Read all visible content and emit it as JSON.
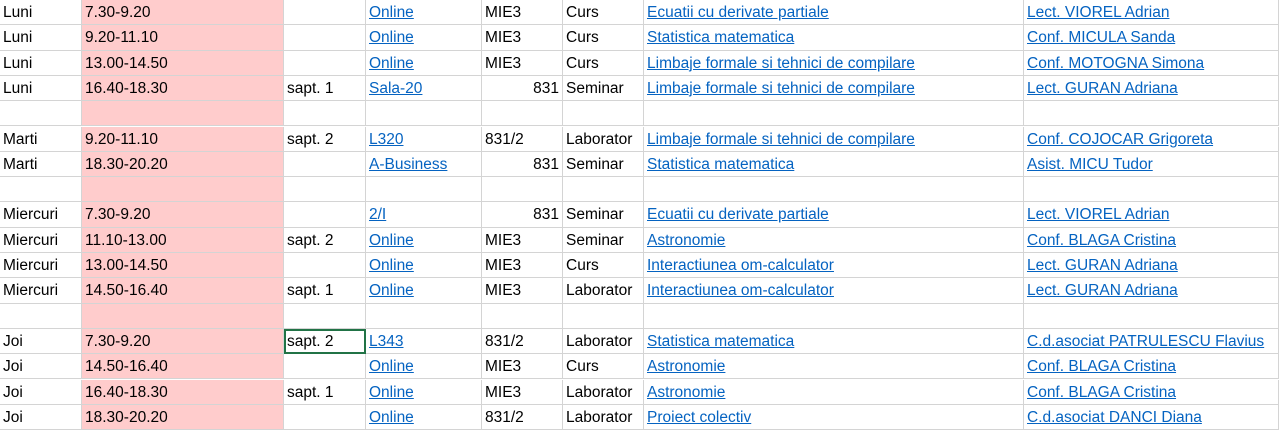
{
  "rows": [
    {
      "day": "Luni",
      "time": "7.30-9.20",
      "week": "",
      "room": "Online",
      "group": "MIE3",
      "type": "Curs",
      "course": "Ecuatii cu derivate partiale",
      "teacher": "Lect. VIOREL Adrian"
    },
    {
      "day": "Luni",
      "time": "9.20-11.10",
      "week": "",
      "room": "Online",
      "group": "MIE3",
      "type": "Curs",
      "course": "Statistica matematica",
      "teacher": "Conf. MICULA Sanda"
    },
    {
      "day": "Luni",
      "time": "13.00-14.50",
      "week": "",
      "room": "Online",
      "group": "MIE3",
      "type": "Curs",
      "course": "Limbaje formale si tehnici de compilare",
      "teacher": "Conf. MOTOGNA Simona"
    },
    {
      "day": "Luni",
      "time": "16.40-18.30",
      "week": "sapt. 1",
      "room": "Sala-20",
      "group": "831",
      "type": "Seminar",
      "course": "Limbaje formale si tehnici de compilare",
      "teacher": "Lect. GURAN Adriana"
    },
    {
      "day": "",
      "time": "",
      "week": "",
      "room": "",
      "group": "",
      "type": "",
      "course": "",
      "teacher": ""
    },
    {
      "day": "Marti",
      "time": "9.20-11.10",
      "week": "sapt. 2",
      "room": "L320",
      "group": "831/2",
      "type": "Laborator",
      "course": "Limbaje formale si tehnici de compilare",
      "teacher": "Conf. COJOCAR Grigoreta"
    },
    {
      "day": "Marti",
      "time": "18.30-20.20",
      "week": "",
      "room": "A-Business",
      "group": "831",
      "type": "Seminar",
      "course": "Statistica matematica",
      "teacher": "Asist. MICU Tudor"
    },
    {
      "day": "",
      "time": "",
      "week": "",
      "room": "",
      "group": "",
      "type": "",
      "course": "",
      "teacher": ""
    },
    {
      "day": "Miercuri",
      "time": "7.30-9.20",
      "week": "",
      "room": "2/I",
      "group": "831",
      "type": "Seminar",
      "course": "Ecuatii cu derivate partiale",
      "teacher": "Lect. VIOREL Adrian"
    },
    {
      "day": "Miercuri",
      "time": "11.10-13.00",
      "week": "sapt. 2",
      "room": "Online",
      "group": "MIE3",
      "type": "Seminar",
      "course": "Astronomie",
      "teacher": "Conf. BLAGA Cristina"
    },
    {
      "day": "Miercuri",
      "time": "13.00-14.50",
      "week": "",
      "room": "Online",
      "group": "MIE3",
      "type": "Curs",
      "course": "Interactiunea om-calculator",
      "teacher": "Lect. GURAN Adriana"
    },
    {
      "day": "Miercuri",
      "time": "14.50-16.40",
      "week": "sapt. 1",
      "room": "Online",
      "group": "MIE3",
      "type": "Laborator",
      "course": "Interactiunea om-calculator",
      "teacher": "Lect. GURAN Adriana"
    },
    {
      "day": "",
      "time": "",
      "week": "",
      "room": "",
      "group": "",
      "type": "",
      "course": "",
      "teacher": ""
    },
    {
      "day": "Joi",
      "time": "7.30-9.20",
      "week": "sapt. 2",
      "room": "L343",
      "group": "831/2",
      "type": "Laborator",
      "course": "Statistica matematica",
      "teacher": "C.d.asociat PATRULESCU Flavius"
    },
    {
      "day": "Joi",
      "time": "14.50-16.40",
      "week": "",
      "room": "Online",
      "group": "MIE3",
      "type": "Curs",
      "course": "Astronomie",
      "teacher": "Conf. BLAGA Cristina"
    },
    {
      "day": "Joi",
      "time": "16.40-18.30",
      "week": "sapt. 1",
      "room": "Online",
      "group": "MIE3",
      "type": "Laborator",
      "course": "Astronomie",
      "teacher": "Conf. BLAGA Cristina"
    },
    {
      "day": "Joi",
      "time": "18.30-20.20",
      "week": "",
      "room": "Online",
      "group": "831/2",
      "type": "Laborator",
      "course": "Proiect colectiv",
      "teacher": "C.d.asociat DANCI Diana"
    }
  ],
  "right_aligned_groups": [
    "831"
  ],
  "selected_cell": {
    "row": 13,
    "col": "week"
  },
  "colors": {
    "time_fill": "#ffcccc",
    "link": "#0563c1",
    "grid": "#d4d4d4",
    "selection": "#217346"
  }
}
